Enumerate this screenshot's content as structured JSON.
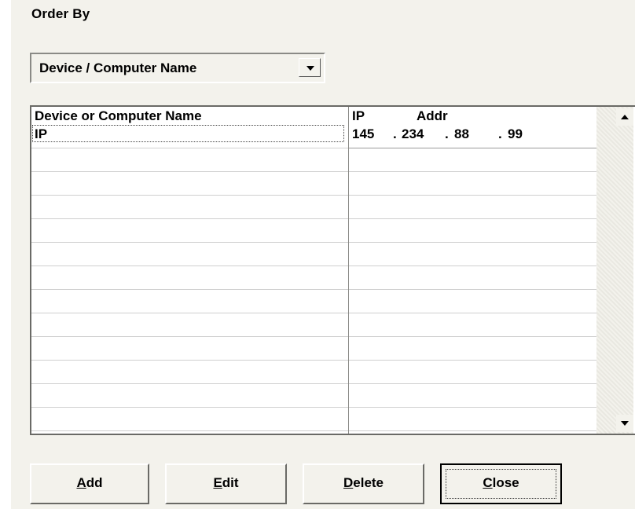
{
  "order_by": {
    "label": "Order By",
    "selected": "Device / Computer Name"
  },
  "list": {
    "columns": {
      "name": "Device or Computer Name",
      "ip": "IP",
      "addr": "Addr"
    },
    "rows": [
      {
        "name": "IP",
        "ip": [
          "145",
          ".",
          "234",
          ".",
          "88",
          ".",
          "99"
        ]
      }
    ]
  },
  "buttons": {
    "add": {
      "mnemonic": "A",
      "rest": "dd"
    },
    "edit": {
      "mnemonic": "E",
      "rest": "dit"
    },
    "delete": {
      "mnemonic": "D",
      "rest": "elete"
    },
    "close": {
      "mnemonic": "C",
      "rest": "lose"
    }
  },
  "colors": {
    "background": "#f3f2ec",
    "list_background": "#ffffff"
  }
}
